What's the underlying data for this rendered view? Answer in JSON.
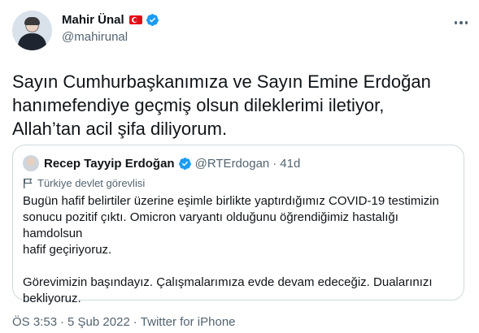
{
  "author": {
    "display_name": "Mahir Ünal",
    "handle": "@mahirunal"
  },
  "tweet": {
    "text": "Sayın Cumhurbaşkanımıza ve Sayın Emine Erdoğan\nhanımefendiye geçmiş olsun dileklerimi iletiyor,\nAllah’tan acil şifa diliyorum."
  },
  "quoted": {
    "display_name": "Recep Tayyip Erdoğan",
    "handle": "@RTErdogan",
    "dot": "·",
    "time": "41d",
    "label": "Türkiye devlet görevlisi",
    "text": "Bugün hafif belirtiler üzerine eşimle birlikte yaptırdığımız COVID-19 testimizin\nsonucu pozitif çıktı. Omicron varyantı olduğunu öğrendiğimiz hastalığı hamdolsun\nhafif geçiriyoruz.\n\nGörevimizin başındayız. Çalışmalarımıza evde devam edeceğiz. Dualarınızı\nbekliyoruz."
  },
  "footer": {
    "time": "ÖS 3:53",
    "dot1": "·",
    "date": "5 Şub 2022",
    "dot2": "·",
    "source": "Twitter for iPhone"
  },
  "icons": {
    "verified": "verified-badge-icon",
    "flag": "turkish-flag-icon",
    "more": "more-options-icon",
    "gov_label": "government-flag-icon"
  },
  "colors": {
    "verified_blue": "#1d9bf0",
    "text_primary": "#0f1419",
    "text_secondary": "#536471",
    "border": "#cfd9de",
    "flag_red": "#e30a17"
  }
}
